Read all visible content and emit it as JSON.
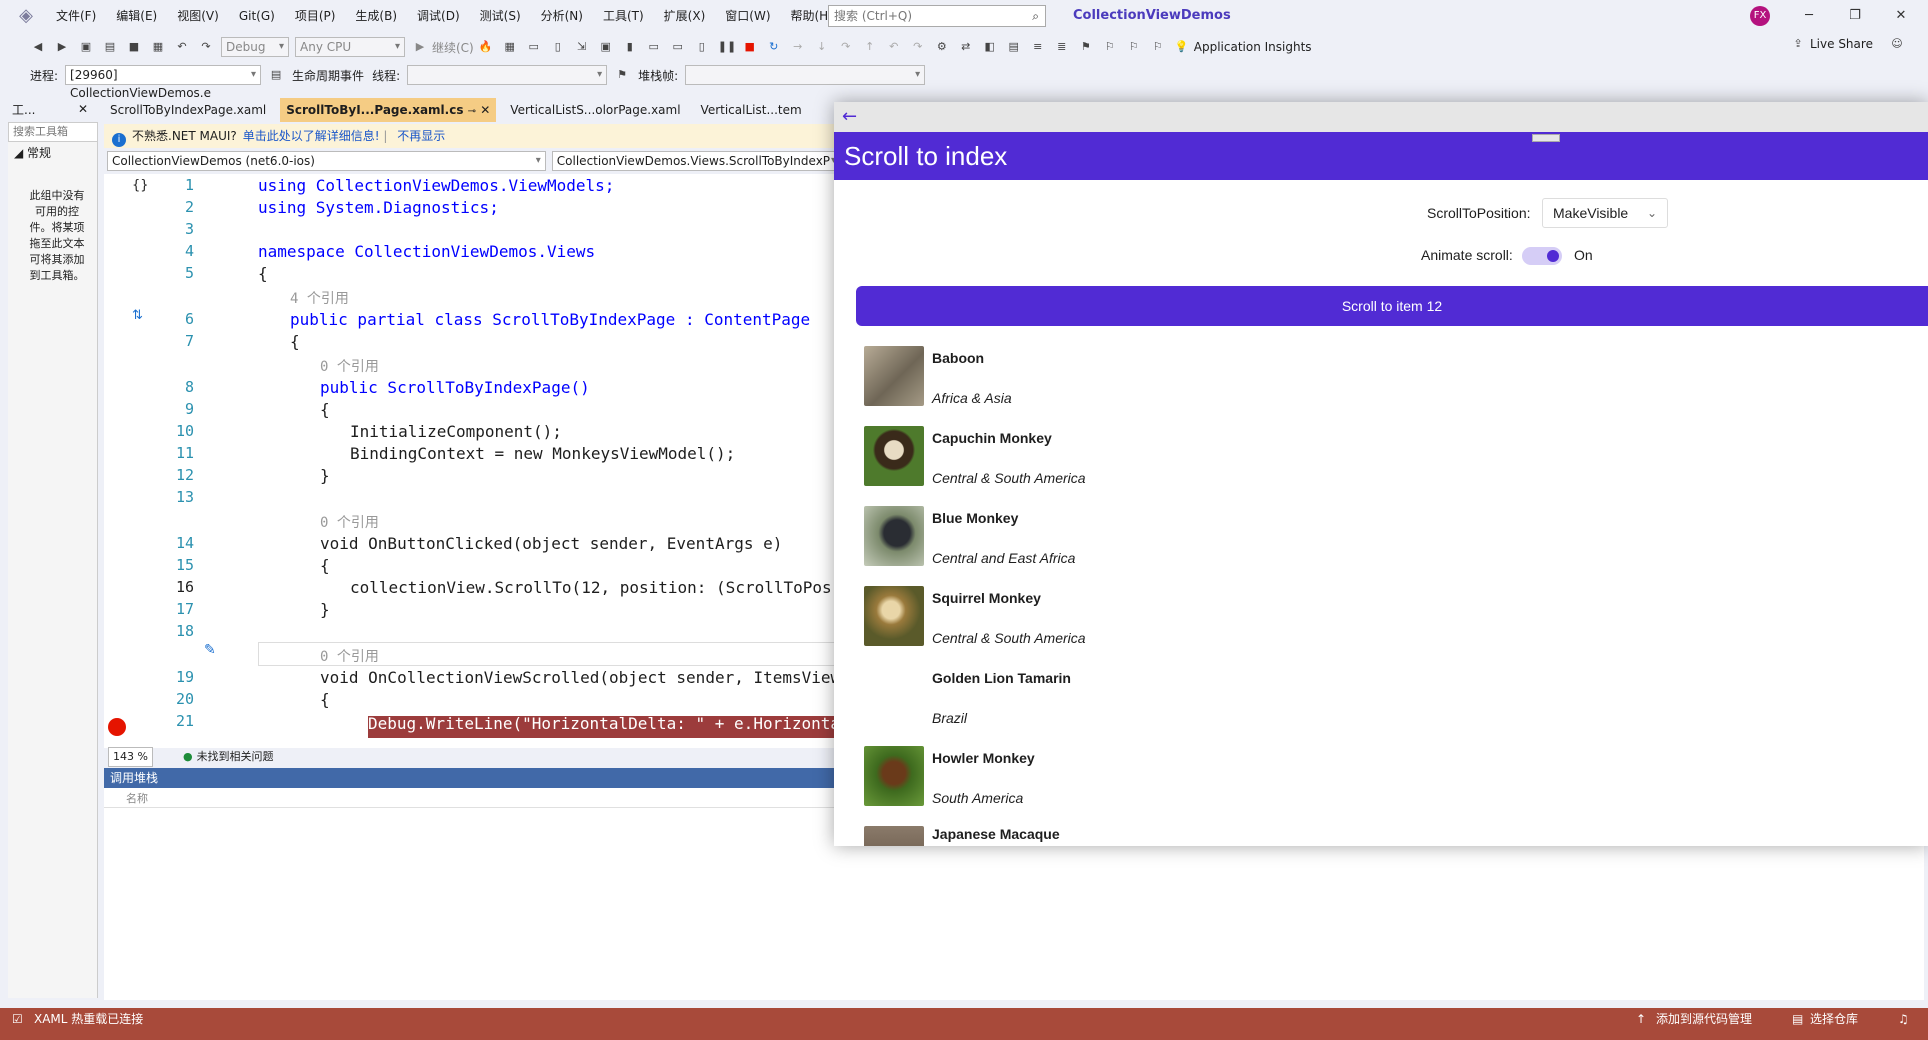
{
  "menubar": {
    "menus": [
      "文件(F)",
      "编辑(E)",
      "视图(V)",
      "Git(G)",
      "项目(P)",
      "生成(B)",
      "调试(D)",
      "测试(S)",
      "分析(N)",
      "工具(T)",
      "扩展(X)",
      "窗口(W)",
      "帮助(H)"
    ],
    "search_placeholder": "搜索 (Ctrl+Q)",
    "solution_title": "CollectionViewDemos",
    "avatar_initials": "FX"
  },
  "toolbar": {
    "config": "Debug",
    "platform": "Any CPU",
    "continue_label": "继续(C)",
    "app_insights": "Application Insights",
    "live_share": "Live Share"
  },
  "toolbar2": {
    "process_label": "进程:",
    "process_value": "[29960] CollectionViewDemos.e",
    "lifecycle_label": "生命周期事件",
    "thread_label": "线程:",
    "stackframe_label": "堆栈帧:"
  },
  "toolbox": {
    "title": "工...",
    "search_placeholder": "搜索工具箱",
    "group": "常规",
    "empty_text": "此组中没有可用的控件。将某项拖至此文本可将其添加到工具箱。"
  },
  "tabs": [
    "ScrollToByIndexPage.xaml",
    "ScrollToByI...Page.xaml.cs",
    "VerticalListS...olorPage.xaml",
    "VerticalList...tem"
  ],
  "infobar": {
    "text": "不熟悉.NET MAUI?",
    "link1": "单击此处以了解详细信息!",
    "link2": "不再显示"
  },
  "navbar": {
    "project": "CollectionViewDemos (net6.0-ios)",
    "type": "CollectionViewDemos.Views.ScrollToByIndexP"
  },
  "code": {
    "line_numbers": [
      "1",
      "2",
      "3",
      "4",
      "5",
      "6",
      "7",
      "8",
      "9",
      "10",
      "11",
      "12",
      "13",
      "14",
      "15",
      "16",
      "17",
      "18",
      "19",
      "20",
      "21"
    ],
    "refs4": "4 个引用",
    "refs0": "0 个引用",
    "l1": "using CollectionViewDemos.ViewModels;",
    "l2": "using System.Diagnostics;",
    "l4": "namespace CollectionViewDemos.Views",
    "l6": "public partial class ScrollToByIndexPage : ContentPage",
    "l8": "public ScrollToByIndexPage()",
    "l10": "InitializeComponent();",
    "l11": "BindingContext = new MonkeysViewModel();",
    "l14": "void OnButtonClicked(object sender, EventArgs e)",
    "l16": "collectionView.ScrollTo(12, position: (ScrollToPos",
    "l19": "void OnCollectionViewScrolled(object sender, ItemsView",
    "l21": "Debug.WriteLine(\"HorizontalDelta: \" + e.Horizontal"
  },
  "editstatus": {
    "zoom": "143 %",
    "issues": "未找到相关问题"
  },
  "callstack": {
    "title": "调用堆栈",
    "col_name": "名称"
  },
  "statusbar": {
    "left": "XAML 热重载已连接",
    "source_control": "添加到源代码管理",
    "repo": "选择仓库"
  },
  "app": {
    "page_title": "Scroll to index",
    "position_label": "ScrollToPosition:",
    "position_value": "MakeVisible",
    "animate_label": "Animate scroll:",
    "animate_value": "On",
    "button_label": "Scroll to item 12",
    "items": [
      {
        "name": "Baboon",
        "location": "Africa & Asia"
      },
      {
        "name": "Capuchin Monkey",
        "location": "Central & South America"
      },
      {
        "name": "Blue Monkey",
        "location": "Central and East Africa"
      },
      {
        "name": "Squirrel Monkey",
        "location": "Central & South America"
      },
      {
        "name": "Golden Lion Tamarin",
        "location": "Brazil"
      },
      {
        "name": "Howler Monkey",
        "location": "South America"
      },
      {
        "name": "Japanese Macaque",
        "location": ""
      }
    ]
  },
  "colors": {
    "maui_purple": "#512bd4",
    "status_red": "#a84a3a",
    "active_tab": "#f5cc84"
  }
}
